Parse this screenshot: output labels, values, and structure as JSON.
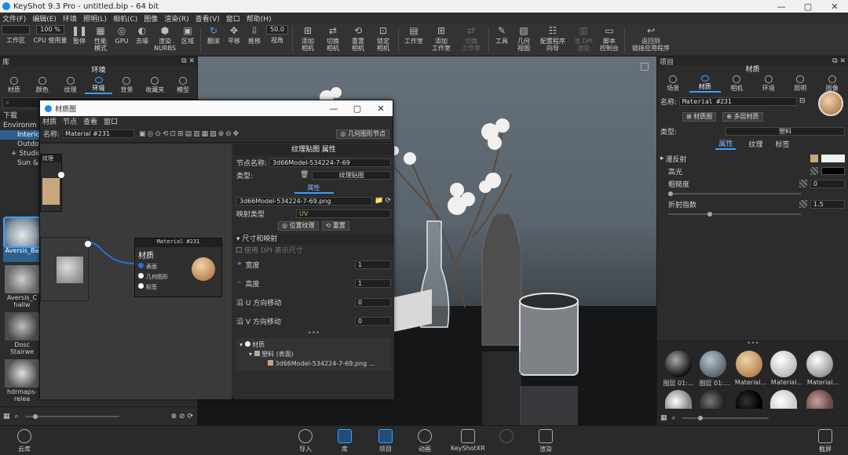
{
  "window": {
    "title": "KeyShot 9.3 Pro - untitled.bip - 64 bit"
  },
  "menu": [
    "文件(F)",
    "编辑(E)",
    "环境",
    "照明(L)",
    "相机(C)",
    "图像",
    "渲染(R)",
    "查看(V)",
    "窗口",
    "帮助(H)"
  ],
  "toolbar": {
    "workspace_value": "",
    "cpu_value": "100 %",
    "view_value": "50.0",
    "buttons": [
      {
        "label": "工作区",
        "icon": "workspace-icon"
      },
      {
        "label": "CPU 使用量",
        "icon": "cpu-usage-icon"
      },
      {
        "label": "暂停",
        "icon": "pause-icon"
      },
      {
        "label": "性能\n模式",
        "icon": "performance-icon"
      },
      {
        "label": "GPU",
        "icon": "gpu-icon"
      },
      {
        "label": "去噪",
        "icon": "denoise-icon"
      },
      {
        "label": "渲染\nNURBS",
        "icon": "nurbs-icon"
      },
      {
        "label": "区域",
        "icon": "region-icon"
      },
      {
        "label": "翻滚",
        "icon": "tumble-icon"
      },
      {
        "label": "平移",
        "icon": "pan-icon"
      },
      {
        "label": "推移",
        "icon": "dolly-icon"
      },
      {
        "label": "视角",
        "icon": "fov-icon"
      },
      {
        "label": "添加\n相机",
        "icon": "add-camera-icon"
      },
      {
        "label": "切换\n相机",
        "icon": "switch-camera-icon"
      },
      {
        "label": "重置\n相机",
        "icon": "reset-camera-icon"
      },
      {
        "label": "锁定\n相机",
        "icon": "lock-camera-icon"
      },
      {
        "label": "工作室",
        "icon": "studio-icon"
      },
      {
        "label": "添加\n工作室",
        "icon": "add-studio-icon"
      },
      {
        "label": "切换\n工作室",
        "icon": "switch-studio-icon"
      },
      {
        "label": "工具",
        "icon": "tools-icon"
      },
      {
        "label": "几何\n视图",
        "icon": "geometry-view-icon"
      },
      {
        "label": "配置程序\n向导",
        "icon": "configurator-icon"
      },
      {
        "label": "渲 DPI\n渲染",
        "icon": "dpi-icon"
      },
      {
        "label": "脚本\n控制台",
        "icon": "script-console-icon"
      },
      {
        "label": "返回到\n链接应用程序",
        "icon": "return-link-icon"
      }
    ]
  },
  "library": {
    "panel_title": "库",
    "section_title": "环境",
    "tabs": [
      "材质",
      "颜色",
      "纹理",
      "环境",
      "背景",
      "收藏夹",
      "模型"
    ],
    "selected_tab": "环境",
    "search_placeholder": "",
    "tree_header": "下载",
    "tree": [
      "Environm",
      "Interic",
      "Outdo",
      "+ Studic",
      "Sun &"
    ],
    "thumbnails": [
      "Aversis_Ba",
      "Aversis_C hallw",
      "Dosc Stairwe",
      "hdrmaps-relea"
    ]
  },
  "material_dialog": {
    "title": "材质图",
    "menu": [
      "材质",
      "节点",
      "查看",
      "窗口"
    ],
    "name_label": "名称:",
    "name_value": "Material #231",
    "geometry_node_btn": "几何图形节点",
    "texture_node": "纹理",
    "material_node": {
      "header": "Material #231",
      "title": "材质",
      "ports": [
        "表面",
        "几何图形",
        "标签"
      ]
    },
    "props": {
      "header": "纹理贴图 属性",
      "node_name_label": "节点名称:",
      "node_name_value": "3d66Model-534224-7-69",
      "type_label": "类型:",
      "type_value": "纹理贴图",
      "attr_tab": "属性",
      "file_value": "3d66Model-534224-7-69.png",
      "mapping_label": "映射类型",
      "mapping_value": "UV",
      "position_btn": "位置纹理",
      "reset_btn": "重置",
      "size_section": "尺寸和映射",
      "dpi_label": "使用 DPI 表示尺寸",
      "fields": [
        {
          "label": "宽度",
          "value": "1"
        },
        {
          "label": "高度",
          "value": "1"
        },
        {
          "label": "沿 U 方向移动",
          "value": "0"
        },
        {
          "label": "沿 V 方向移动",
          "value": "0"
        }
      ],
      "tree": [
        "材质",
        "塑料 (表面)",
        "3d66Model-534224-7-69.png ..."
      ]
    }
  },
  "right_panel": {
    "panel_title": "项目",
    "section_title": "材质",
    "tabs": [
      "场景",
      "材质",
      "相机",
      "环境",
      "照明",
      "图像"
    ],
    "selected_tab": "材质",
    "name_label": "名称:",
    "name_value": "Material #231",
    "material_graph_btn": "材质图",
    "multi_material_btn": "多层材质",
    "type_label": "类型:",
    "type_value": "塑料",
    "subtabs": [
      "属性",
      "纹理",
      "标签"
    ],
    "selected_subtab": "属性",
    "properties": [
      {
        "label": "漫反射",
        "value": ""
      },
      {
        "label": "高光",
        "value": ""
      },
      {
        "label": "粗糙度",
        "value": "0"
      },
      {
        "label": "折射指数",
        "value": "1.5"
      }
    ],
    "swatch_labels": [
      "图层 01:...",
      "图层 01:...",
      "Material...",
      "Material...",
      "Material..."
    ]
  },
  "bottom": {
    "left_label": "云库",
    "buttons": [
      "导入",
      "库",
      "项目",
      "动画",
      "KeyShotXR",
      "渲染"
    ],
    "disabled_label": "",
    "right_label": "截屏"
  }
}
